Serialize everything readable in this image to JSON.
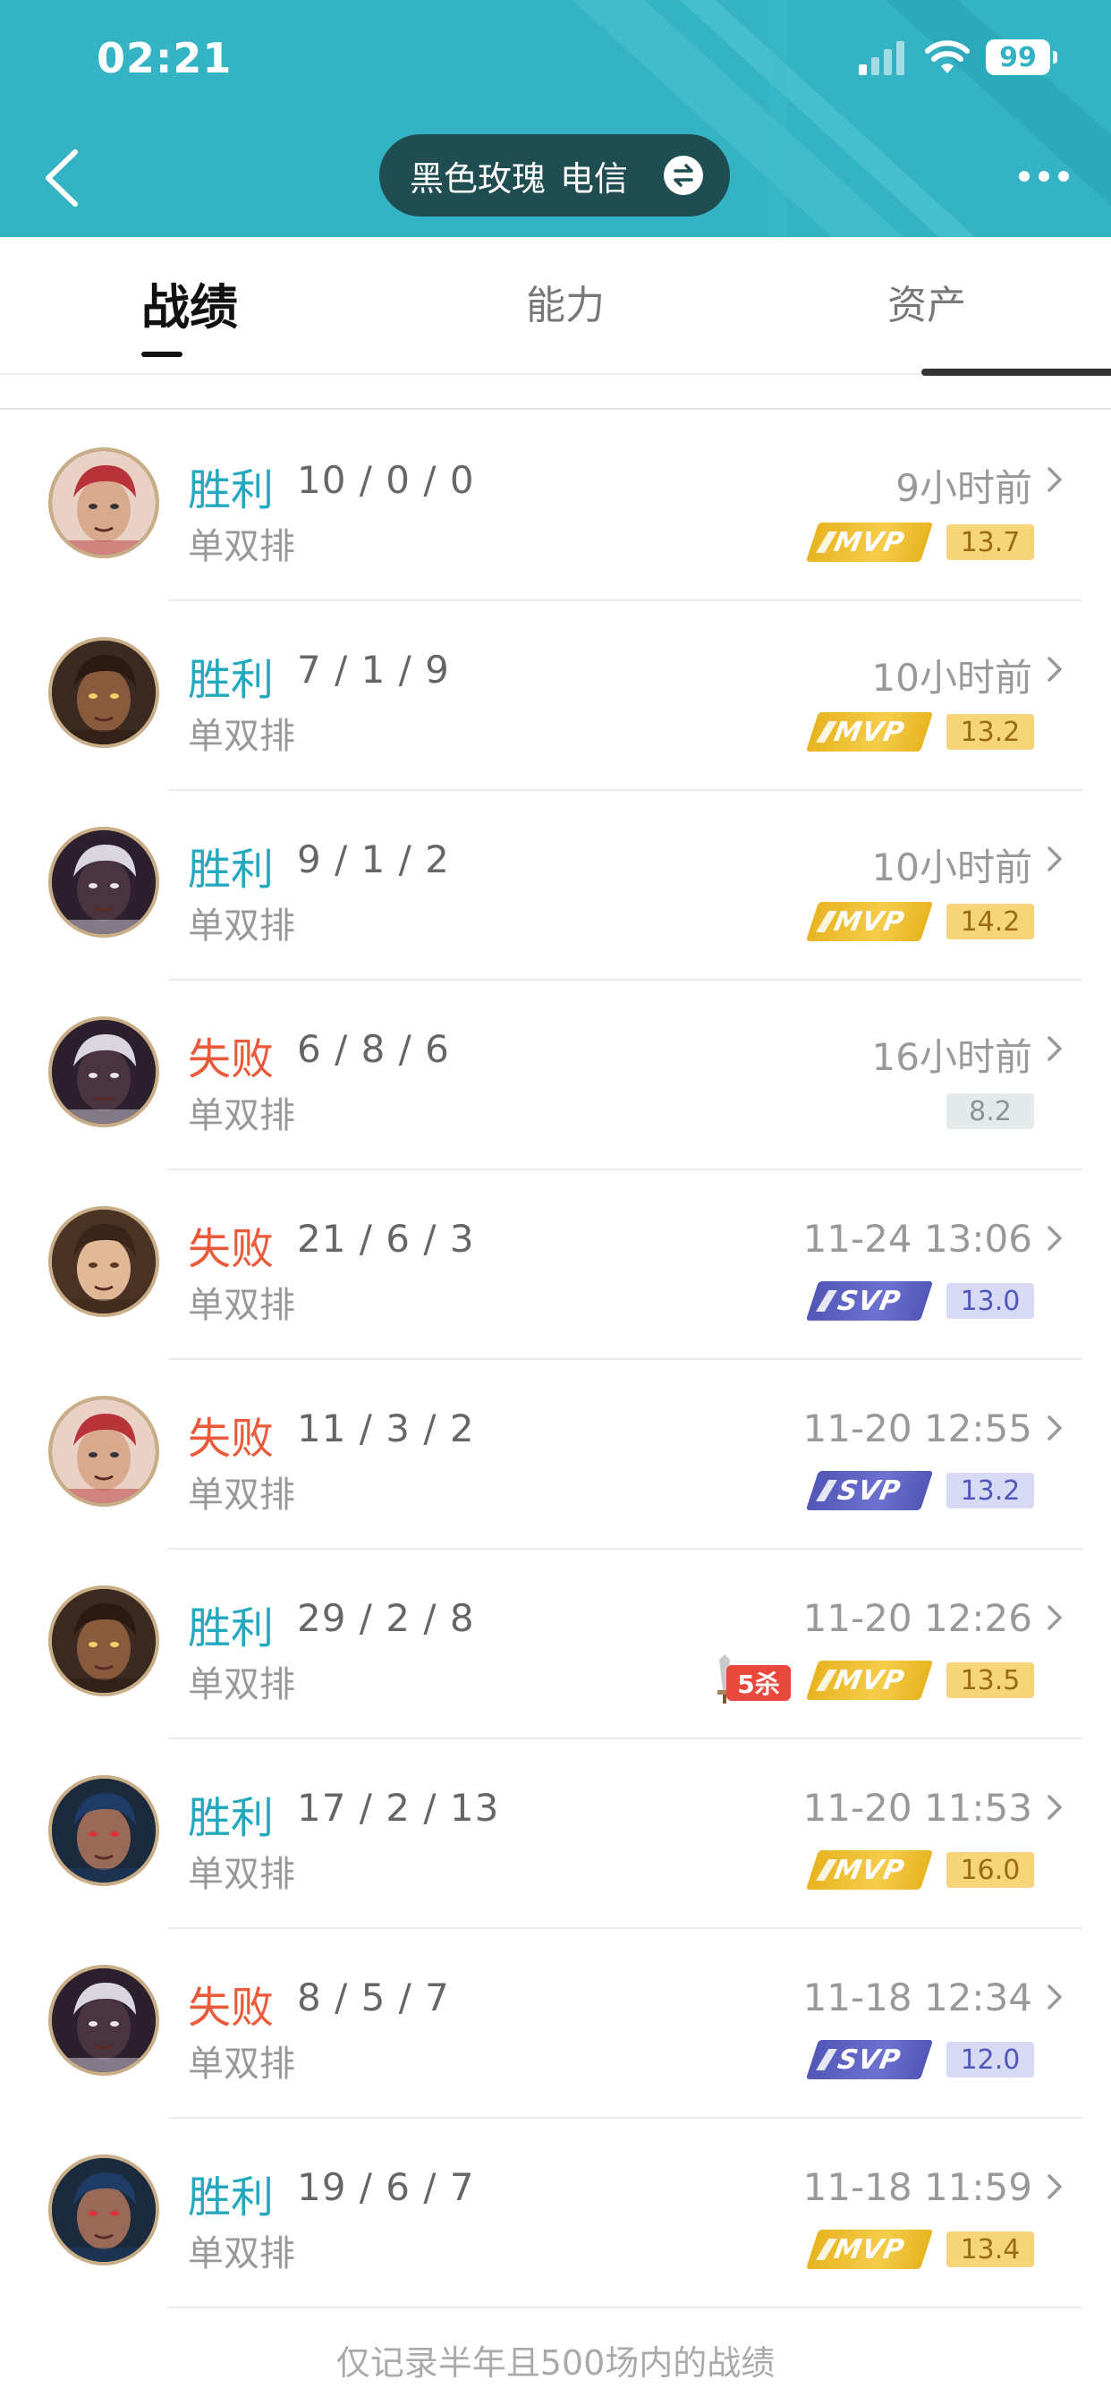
{
  "status_bar": {
    "time": "02:21",
    "battery": "99"
  },
  "header": {
    "account_name": "黑色玫瑰",
    "server": "电信"
  },
  "tabs": [
    {
      "label": "战绩",
      "active": true
    },
    {
      "label": "能力",
      "active": false
    },
    {
      "label": "资产",
      "active": false
    }
  ],
  "matches": [
    {
      "result": "胜利",
      "outcome": "win",
      "kda": "10 / 0 / 0",
      "mode": "单双排",
      "time": "9小时前",
      "badge": "MVP",
      "score": "13.7",
      "avatar": "red-hair-hero",
      "penta": false
    },
    {
      "result": "胜利",
      "outcome": "win",
      "kda": "7 / 1 / 9",
      "mode": "单双排",
      "time": "10小时前",
      "badge": "MVP",
      "score": "13.2",
      "avatar": "bearded-gunner-hero",
      "penta": false
    },
    {
      "result": "胜利",
      "outcome": "win",
      "kda": "9 / 1 / 2",
      "mode": "单双排",
      "time": "10小时前",
      "badge": "MVP",
      "score": "14.2",
      "avatar": "dark-skin-hero",
      "penta": false
    },
    {
      "result": "失败",
      "outcome": "loss",
      "kda": "6 / 8 / 6",
      "mode": "单双排",
      "time": "16小时前",
      "badge": "",
      "score": "8.2",
      "avatar": "dark-skin-hero",
      "penta": false
    },
    {
      "result": "失败",
      "outcome": "loss",
      "kda": "21 / 6 / 3",
      "mode": "单双排",
      "time": "11-24 13:06",
      "badge": "SVP",
      "score": "13.0",
      "avatar": "eyepatch-heroine",
      "penta": false
    },
    {
      "result": "失败",
      "outcome": "loss",
      "kda": "11 / 3 / 2",
      "mode": "单双排",
      "time": "11-20 12:55",
      "badge": "SVP",
      "score": "13.2",
      "avatar": "red-hair-hero",
      "penta": false
    },
    {
      "result": "胜利",
      "outcome": "win",
      "kda": "29 / 2 / 8",
      "mode": "单双排",
      "time": "11-20 12:26",
      "badge": "MVP",
      "score": "13.5",
      "avatar": "bearded-gunner-hero",
      "penta": true,
      "penta_label": "5杀"
    },
    {
      "result": "胜利",
      "outcome": "win",
      "kda": "17 / 2 / 13",
      "mode": "单双排",
      "time": "11-20 11:53",
      "badge": "MVP",
      "score": "16.0",
      "avatar": "blue-hair-hero",
      "penta": false
    },
    {
      "result": "失败",
      "outcome": "loss",
      "kda": "8 / 5 / 7",
      "mode": "单双排",
      "time": "11-18 12:34",
      "badge": "SVP",
      "score": "12.0",
      "avatar": "dark-skin-hero",
      "penta": false
    },
    {
      "result": "胜利",
      "outcome": "win",
      "kda": "19 / 6 / 7",
      "mode": "单双排",
      "time": "11-18 11:59",
      "badge": "MVP",
      "score": "13.4",
      "avatar": "blue-hair-hero",
      "penta": false
    }
  ],
  "footer_note": "仅记录半年且500场内的战绩",
  "colors": {
    "header_bg": "#33b3c3",
    "win": "#23a9bd",
    "loss": "#ea5a3a",
    "mvp": "#e8b421",
    "svp": "#5257b8"
  }
}
